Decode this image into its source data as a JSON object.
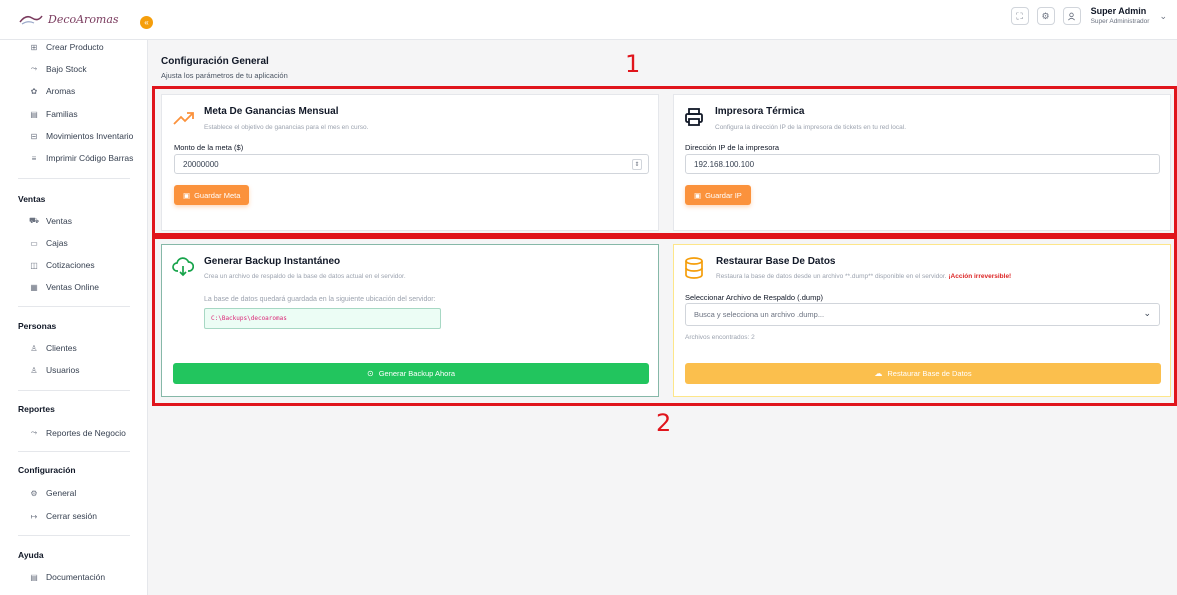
{
  "app": {
    "logo_text": "DecoAromas",
    "collapse_icon": "«"
  },
  "topbar": {
    "user_name": "Super Admin",
    "user_role": "Super Administrador"
  },
  "sidebar": {
    "items_top": [
      {
        "label": "Crear Producto",
        "icon": "box-icon"
      },
      {
        "label": "Bajo Stock",
        "icon": "trend-down-icon"
      },
      {
        "label": "Aromas",
        "icon": "flower-icon"
      },
      {
        "label": "Familias",
        "icon": "folder-icon"
      },
      {
        "label": "Movimientos Inventario",
        "icon": "inbox-icon"
      },
      {
        "label": "Imprimir Código Barras",
        "icon": "barcode-icon"
      }
    ],
    "ventas": {
      "header": "Ventas",
      "items": [
        {
          "label": "Ventas",
          "icon": "cart-icon"
        },
        {
          "label": "Cajas",
          "icon": "cash-icon"
        },
        {
          "label": "Cotizaciones",
          "icon": "document-icon"
        },
        {
          "label": "Ventas Online",
          "icon": "calendar-icon"
        }
      ]
    },
    "personas": {
      "header": "Personas",
      "items": [
        {
          "label": "Clientes",
          "icon": "user-icon"
        },
        {
          "label": "Usuarios",
          "icon": "users-icon"
        }
      ]
    },
    "reportes": {
      "header": "Reportes",
      "items": [
        {
          "label": "Reportes de Negocio",
          "icon": "chart-icon"
        }
      ]
    },
    "configuracion": {
      "header": "Configuración",
      "items": [
        {
          "label": "General",
          "icon": "gear-icon"
        },
        {
          "label": "Cerrar sesión",
          "icon": "logout-icon"
        }
      ]
    },
    "ayuda": {
      "header": "Ayuda",
      "items": [
        {
          "label": "Documentación",
          "icon": "doc-icon"
        }
      ]
    }
  },
  "main": {
    "title": "Configuración General",
    "subtitle": "Ajusta los parámetros de tu aplicación",
    "meta_card": {
      "title": "Meta De Ganancias Mensual",
      "desc": "Establece el objetivo de ganancias para el mes en curso.",
      "label": "Monto de la meta ($)",
      "value": "20000000",
      "button": "Guardar Meta"
    },
    "printer_card": {
      "title": "Impresora Térmica",
      "desc": "Configura la dirección IP de la impresora de tickets en tu red local.",
      "label": "Dirección IP de la impresora",
      "value": "192.168.100.100",
      "button": "Guardar IP"
    },
    "backup_card": {
      "title": "Generar Backup Instantáneo",
      "desc": "Crea un archivo de respaldo de la base de datos actual en el servidor.",
      "location_text": "La base de datos quedará guardada en la siguiente ubicación del servidor:",
      "path": "C:\\Backups\\decoaromas",
      "button": "Generar Backup Ahora"
    },
    "restore_card": {
      "title": "Restaurar Base De Datos",
      "desc": "Restaura la base de datos desde un archivo **.dump** disponible en el servidor.",
      "warning": "¡Acción irreversible!",
      "label": "Seleccionar Archivo de Respaldo (.dump)",
      "placeholder": "Busca y selecciona un archivo .dump...",
      "found": "Archivos encontrados: 2",
      "button": "Restaurar Base de Datos"
    }
  },
  "annotations": {
    "box1": "1",
    "box2": "2"
  },
  "colors": {
    "accent": "#fb923c",
    "green": "#22c55e",
    "annotation": "#e0151c",
    "restore_btn": "#fbbf4d"
  }
}
